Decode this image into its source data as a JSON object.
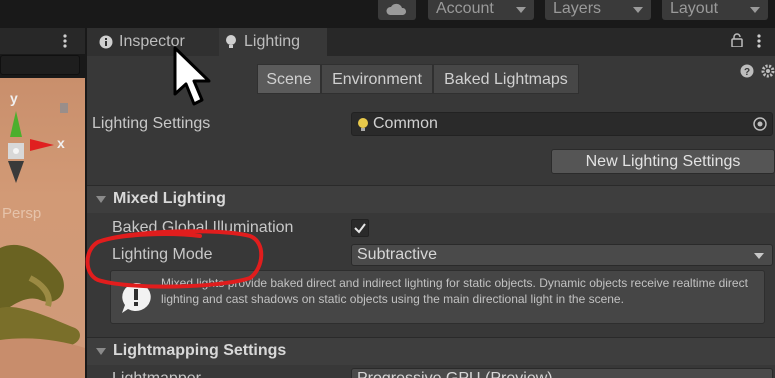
{
  "toolbar": {
    "account_label": "Account",
    "layers_label": "Layers",
    "layout_label": "Layout"
  },
  "scene": {
    "axis_y": "y",
    "axis_x": "x",
    "persp_label": "Persp"
  },
  "tabs": [
    {
      "label": "Inspector"
    },
    {
      "label": "Lighting"
    }
  ],
  "segments": [
    {
      "label": "Scene"
    },
    {
      "label": "Environment"
    },
    {
      "label": "Baked Lightmaps"
    }
  ],
  "lighting_settings": {
    "label": "Lighting Settings",
    "value": "Common",
    "new_button": "New Lighting Settings"
  },
  "mixed_lighting": {
    "title": "Mixed Lighting",
    "baked_gi_label": "Baked Global Illumination",
    "baked_gi_checked": true,
    "mode_label": "Lighting Mode",
    "mode_value": "Subtractive",
    "help_text": "Mixed lights provide baked direct and indirect lighting for static objects. Dynamic objects receive realtime direct lighting and cast shadows on static objects using the main directional light in the scene."
  },
  "lightmapping": {
    "title": "Lightmapping Settings",
    "lightmapper_label": "Lightmapper",
    "lightmapper_value": "Progressive GPU (Preview)"
  },
  "colors": {
    "annotation_circle": "#e11d1d",
    "panel_bg": "#383838"
  }
}
